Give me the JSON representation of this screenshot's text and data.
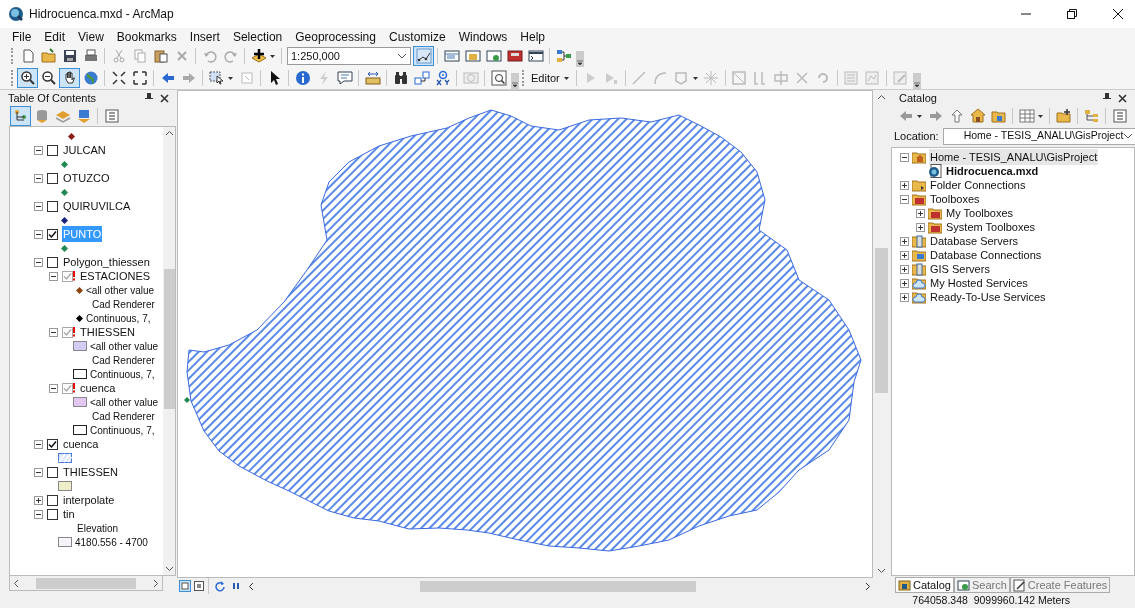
{
  "window": {
    "title": "Hidrocuenca.mxd - ArcMap"
  },
  "menu": [
    "File",
    "Edit",
    "View",
    "Bookmarks",
    "Insert",
    "Selection",
    "Geoprocessing",
    "Customize",
    "Windows",
    "Help"
  ],
  "standard_toolbar": {
    "scale": "1:250,000"
  },
  "tools_toolbar": {
    "editor_menu": "Editor"
  },
  "table_of_contents": {
    "title": "Table Of Contents",
    "layers": [
      {
        "kind": "point",
        "color": "#8b1a1a"
      },
      {
        "kind": "layer",
        "label": "JULCAN",
        "checked": false,
        "expanded": true,
        "selected": false,
        "children": [
          {
            "kind": "point",
            "color": "#1e8a50"
          }
        ]
      },
      {
        "kind": "layer",
        "label": "OTUZCO",
        "checked": false,
        "expanded": true,
        "selected": false,
        "children": [
          {
            "kind": "point",
            "color": "#1e8a50"
          }
        ]
      },
      {
        "kind": "layer",
        "label": "QUIRUVILCA",
        "checked": false,
        "expanded": true,
        "selected": false,
        "children": [
          {
            "kind": "point",
            "color": "#1a237e"
          }
        ]
      },
      {
        "kind": "layer",
        "label": "PUNTO",
        "checked": true,
        "expanded": true,
        "selected": true,
        "children": [
          {
            "kind": "point",
            "color": "#1e8a50"
          }
        ]
      },
      {
        "kind": "layer",
        "label": "Polygon_thiessen",
        "checked": false,
        "expanded": true,
        "selected": false,
        "children": [
          {
            "kind": "sublayer",
            "label": "ESTACIONES",
            "checked": true,
            "expanded": true,
            "selected": false,
            "children": [
              {
                "kind": "point",
                "color": "#8b4513",
                "label": "<all other value"
              },
              {
                "kind": "text",
                "label": "Cad Renderer"
              },
              {
                "kind": "point",
                "color": "#000000",
                "label": "Continuous, 7,"
              }
            ]
          },
          {
            "kind": "sublayer",
            "label": "THIESSEN",
            "checked": true,
            "expanded": true,
            "selected": false,
            "children": [
              {
                "kind": "fill",
                "color": "#d4ccf4",
                "label": "<all other value"
              },
              {
                "kind": "text",
                "label": "Cad Renderer"
              },
              {
                "kind": "outline",
                "label": "Continuous, 7,"
              }
            ]
          },
          {
            "kind": "sublayer",
            "label": "cuenca",
            "checked": true,
            "expanded": true,
            "selected": false,
            "children": [
              {
                "kind": "fill",
                "color": "#e6c6f4",
                "label": "<all other value"
              },
              {
                "kind": "text",
                "label": "Cad Renderer"
              },
              {
                "kind": "outline",
                "label": "Continuous, 7,"
              }
            ]
          }
        ]
      },
      {
        "kind": "layer",
        "label": "cuenca",
        "checked": true,
        "expanded": true,
        "selected": false,
        "children": [
          {
            "kind": "hatch"
          }
        ]
      },
      {
        "kind": "layer",
        "label": "THIESSEN",
        "checked": false,
        "expanded": true,
        "selected": false,
        "children": [
          {
            "kind": "fill",
            "color": "#eeeec8"
          }
        ]
      },
      {
        "kind": "layer",
        "label": "interpolate",
        "checked": false,
        "expanded": false,
        "selected": false
      },
      {
        "kind": "layer",
        "label": "tin",
        "checked": false,
        "expanded": true,
        "selected": false,
        "children": [
          {
            "kind": "text",
            "label": "Elevation"
          },
          {
            "kind": "fill",
            "color": "#f6f4fa",
            "label": "4180.556 - 4700"
          }
        ]
      }
    ]
  },
  "catalog": {
    "title": "Catalog",
    "location_label": "Location:",
    "location": "Home - TESIS_ANALU\\GisProject",
    "items": [
      {
        "kind": "home-folder",
        "label": "Home - TESIS_ANALU\\GisProject",
        "expanded": true,
        "selected": true,
        "children": [
          {
            "kind": "map-document",
            "label": "Hidrocuenca.mxd",
            "selected": false
          }
        ]
      },
      {
        "kind": "folder",
        "label": "Folder Connections",
        "expanded": false,
        "selected": false
      },
      {
        "kind": "toolbox",
        "label": "Toolboxes",
        "expanded": true,
        "selected": false,
        "children": [
          {
            "kind": "toolbox",
            "label": "My Toolboxes",
            "expanded": false,
            "selected": false
          },
          {
            "kind": "toolbox",
            "label": "System Toolboxes",
            "expanded": false,
            "selected": false
          }
        ]
      },
      {
        "kind": "server",
        "label": "Database Servers",
        "expanded": false,
        "selected": false
      },
      {
        "kind": "database",
        "label": "Database Connections",
        "expanded": false,
        "selected": false
      },
      {
        "kind": "server",
        "label": "GIS Servers",
        "expanded": false,
        "selected": false
      },
      {
        "kind": "cloud",
        "label": "My Hosted Services",
        "expanded": false,
        "selected": false
      },
      {
        "kind": "cloud",
        "label": "Ready-To-Use Services",
        "expanded": false,
        "selected": false
      }
    ]
  },
  "dock_tabs": [
    {
      "label": "Catalog",
      "selected": true
    },
    {
      "label": "Search",
      "selected": false
    },
    {
      "label": "Create Features",
      "selected": false
    }
  ],
  "status_bar": {
    "coordinates": "764058.348  9099960.142 Meters"
  }
}
